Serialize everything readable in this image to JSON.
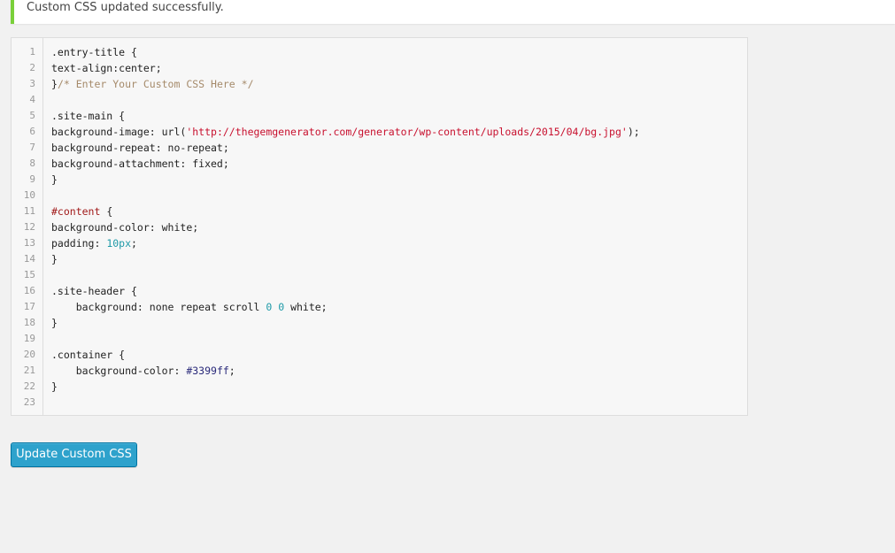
{
  "notice": {
    "message": "Custom CSS updated successfully."
  },
  "editor": {
    "lines": [
      [
        {
          "t": ".entry-title {",
          "c": "plain"
        }
      ],
      [
        {
          "t": "text-align:center;",
          "c": "plain"
        }
      ],
      [
        {
          "t": "}",
          "c": "plain"
        },
        {
          "t": "/* Enter Your Custom CSS Here */",
          "c": "comment"
        }
      ],
      [],
      [
        {
          "t": ".site-main {",
          "c": "plain"
        }
      ],
      [
        {
          "t": "background-image: url(",
          "c": "plain"
        },
        {
          "t": "'http://thegemgenerator.com/generator/wp-content/uploads/2015/04/bg.jpg'",
          "c": "string"
        },
        {
          "t": ");",
          "c": "plain"
        }
      ],
      [
        {
          "t": "background-repeat: no-repeat;",
          "c": "plain"
        }
      ],
      [
        {
          "t": "background-attachment: fixed;",
          "c": "plain"
        }
      ],
      [
        {
          "t": "}",
          "c": "plain"
        }
      ],
      [],
      [
        {
          "t": "#content",
          "c": "id"
        },
        {
          "t": " {",
          "c": "plain"
        }
      ],
      [
        {
          "t": "background-color: white;",
          "c": "plain"
        }
      ],
      [
        {
          "t": "padding: ",
          "c": "plain"
        },
        {
          "t": "10px",
          "c": "number"
        },
        {
          "t": ";",
          "c": "plain"
        }
      ],
      [
        {
          "t": "}",
          "c": "plain"
        }
      ],
      [],
      [
        {
          "t": ".site-header {",
          "c": "plain"
        }
      ],
      [
        {
          "t": "    background: none repeat scroll ",
          "c": "plain"
        },
        {
          "t": "0",
          "c": "number"
        },
        {
          "t": " ",
          "c": "plain"
        },
        {
          "t": "0",
          "c": "number"
        },
        {
          "t": " white;",
          "c": "plain"
        }
      ],
      [
        {
          "t": "}",
          "c": "plain"
        }
      ],
      [],
      [
        {
          "t": ".container {",
          "c": "plain"
        }
      ],
      [
        {
          "t": "    background-color: ",
          "c": "plain"
        },
        {
          "t": "#3399ff",
          "c": "hex"
        },
        {
          "t": ";",
          "c": "plain"
        }
      ],
      [
        {
          "t": "}",
          "c": "plain"
        }
      ],
      []
    ]
  },
  "actions": {
    "update_label": "Update Custom CSS"
  },
  "colors": {
    "notice_border": "#7ad03a",
    "button_bg": "#2ea2cc",
    "button_border": "#0074a2",
    "string": "#c8102e",
    "comment": "#a58a6a",
    "number": "#1e9aa8"
  }
}
